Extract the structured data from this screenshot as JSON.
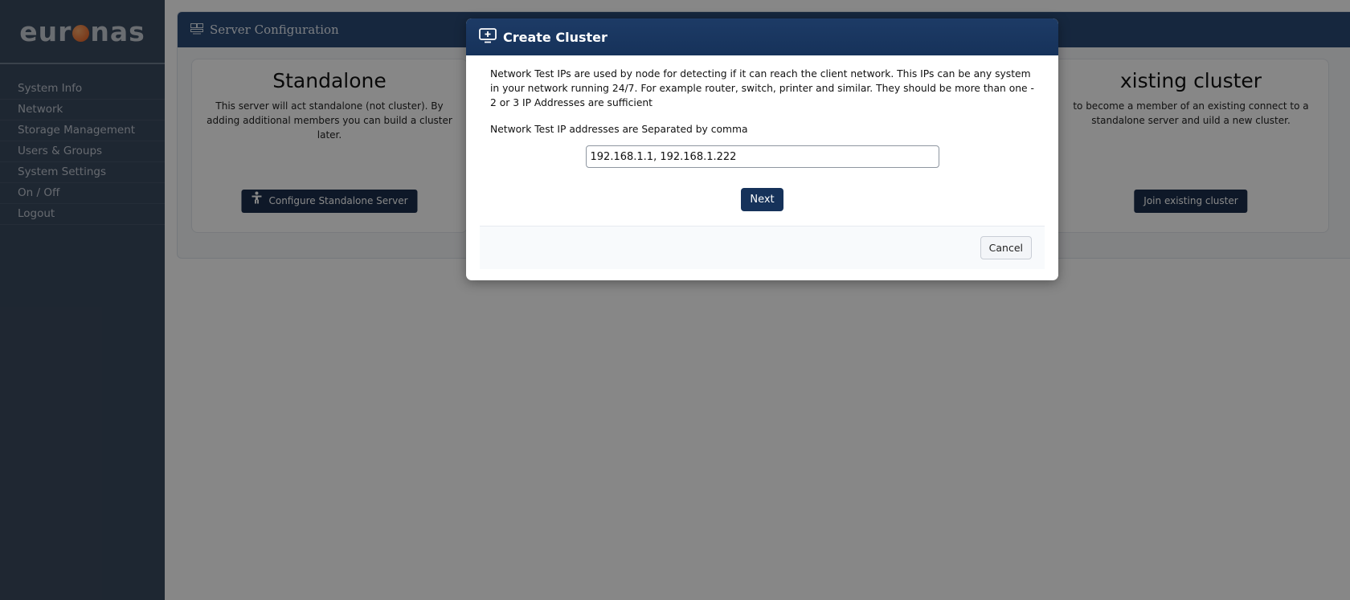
{
  "brand": {
    "logo_prefix": "eur",
    "logo_suffix": "nas",
    "accent": "#e2571c"
  },
  "sidebar": {
    "items": [
      {
        "label": "System Info"
      },
      {
        "label": "Network"
      },
      {
        "label": "Storage Management"
      },
      {
        "label": "Users & Groups"
      },
      {
        "label": "System Settings"
      },
      {
        "label": "On / Off"
      },
      {
        "label": "Logout"
      }
    ]
  },
  "panel": {
    "title": "Server  Configuration",
    "icon": "server-config-icon",
    "standalone": {
      "title": "Standalone",
      "description": "This server will act standalone (not cluster). By adding additional members you can build a cluster later.",
      "button_label": "Configure Standalone Server",
      "button_icon": "person-icon"
    },
    "join": {
      "title": "xisting cluster",
      "description": "to become a member of an existing connect to a standalone server and uild a new cluster.",
      "button_label": "Join existing cluster"
    }
  },
  "modal": {
    "title": "Create Cluster",
    "icon": "cluster-add-icon",
    "description": "Network Test IPs are used by node for detecting if it can reach the client network. This IPs can be any system in your network running 24/7. For example router, switch, printer and similar. They should be more than one - 2 or 3 IP Addresses are sufficient",
    "ip_label": "Network Test IP addresses are Separated by comma",
    "ip_value": "192.168.1.1, 192.168.1.222",
    "next_label": "Next",
    "cancel_label": "Cancel"
  },
  "colors": {
    "sidebar_bg": "#3a4a5f",
    "header_bg": "#16325a",
    "button_bg": "#1b2f4d"
  }
}
